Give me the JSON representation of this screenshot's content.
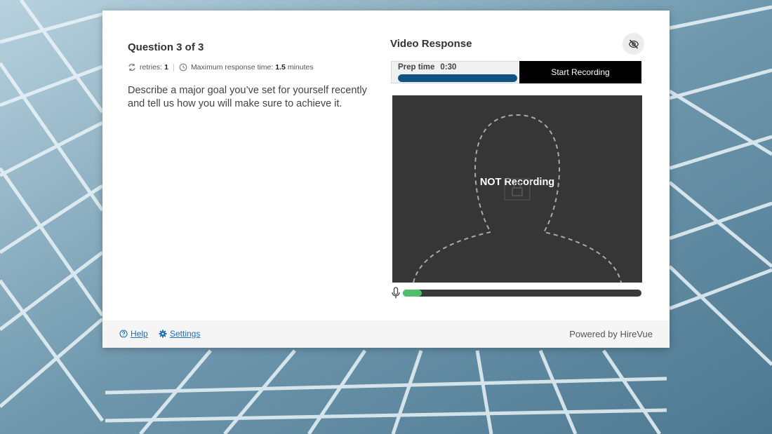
{
  "question": {
    "title": "Question 3 of 3",
    "retries_label": "retries:",
    "retries_value": "1",
    "max_time_label": "Maximum response time:",
    "max_time_value": "1.5",
    "max_time_unit": "minutes",
    "text": "Describe a major goal you’ve set for yourself recently and tell us how you will make sure to achieve it."
  },
  "video_response": {
    "title": "Video Response",
    "hide_icon": "eye-slash-icon",
    "prep_label": "Prep time",
    "prep_time": "0:30",
    "prep_progress": 1.0,
    "start_label": "Start Recording",
    "status": "NOT Recording",
    "mic_level": 0.08
  },
  "footer": {
    "help_label": "Help",
    "settings_label": "Settings",
    "powered_by": "Powered by HireVue"
  },
  "colors": {
    "prep_bar": "#0e5384",
    "mic_level": "#4fbf6e",
    "link": "#1a6fb4",
    "video_bg": "#363636"
  }
}
